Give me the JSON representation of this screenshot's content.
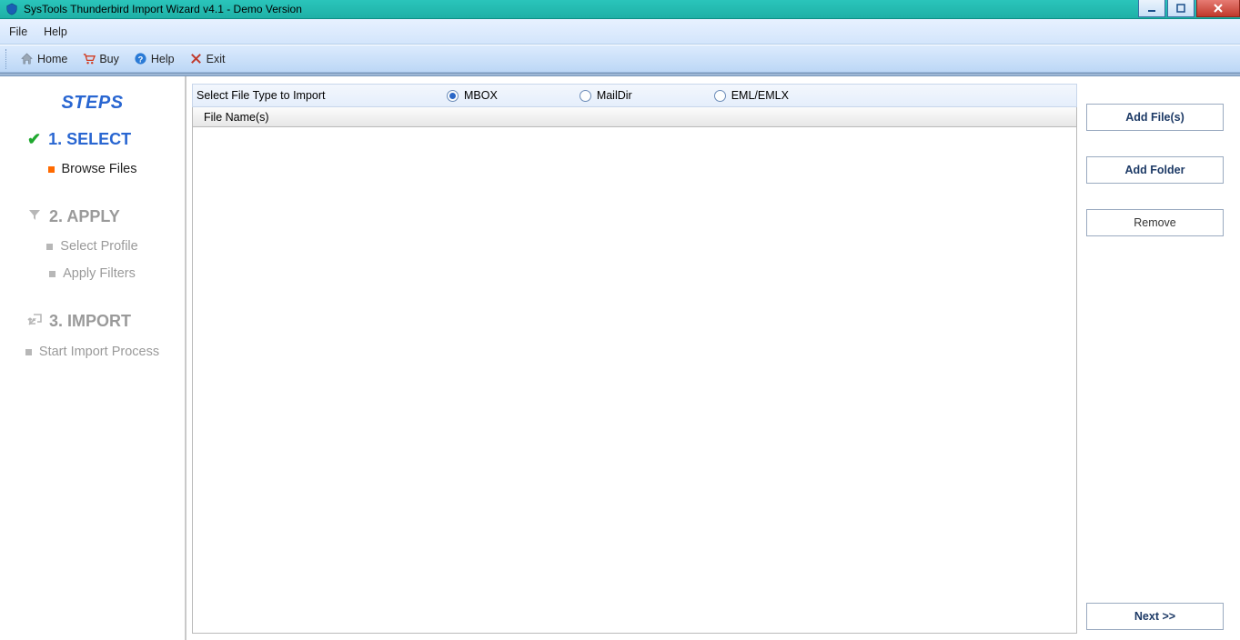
{
  "window": {
    "title": "SysTools Thunderbird Import Wizard v4.1 - Demo Version"
  },
  "menu": {
    "file": "File",
    "help": "Help"
  },
  "toolbar": {
    "home": "Home",
    "buy": "Buy",
    "help": "Help",
    "exit": "Exit"
  },
  "sidebar": {
    "title": "STEPS",
    "step1": {
      "label": "1. SELECT",
      "sub1": "Browse Files"
    },
    "step2": {
      "label": "2. APPLY",
      "sub1": "Select Profile",
      "sub2": "Apply Filters"
    },
    "step3": {
      "label": "3. IMPORT",
      "sub1": "Start Import Process"
    }
  },
  "main": {
    "select_label": "Select File Type to Import",
    "radio": {
      "mbox": "MBOX",
      "maildir": "MailDir",
      "eml": "EML/EMLX"
    },
    "table_header": "File Name(s)"
  },
  "buttons": {
    "add_files": "Add File(s)",
    "add_folder": "Add Folder",
    "remove": "Remove",
    "next": "Next >>"
  }
}
